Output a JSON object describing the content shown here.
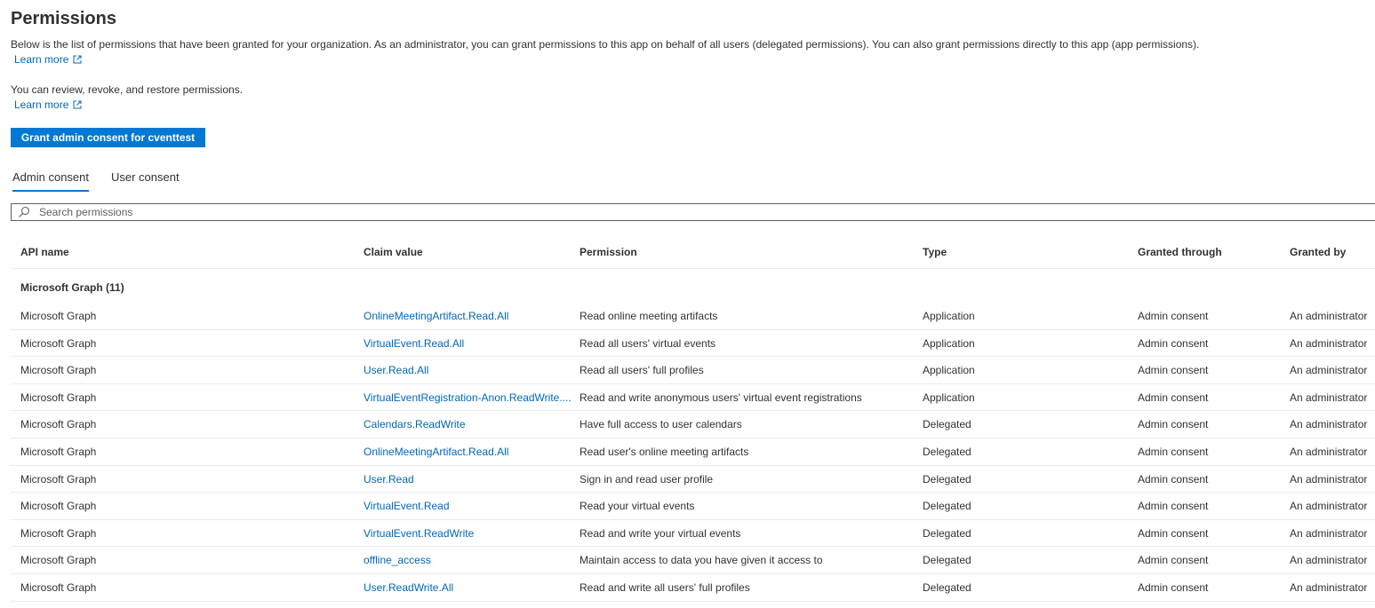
{
  "page": {
    "title": "Permissions",
    "description1": "Below is the list of permissions that have been granted for your organization. As an administrator, you can grant permissions to this app on behalf of all users (delegated permissions). You can also grant permissions directly to this app (app permissions).",
    "learn_more_1": "Learn more",
    "description2": "You can review, revoke, and restore permissions.",
    "learn_more_2": "Learn more",
    "grant_button": "Grant admin consent for cventtest"
  },
  "tabs": [
    {
      "label": "Admin consent",
      "active": true
    },
    {
      "label": "User consent",
      "active": false
    }
  ],
  "search": {
    "placeholder": "Search permissions",
    "value": ""
  },
  "table": {
    "columns": [
      "API name",
      "Claim value",
      "Permission",
      "Type",
      "Granted through",
      "Granted by"
    ],
    "group_label": "Microsoft Graph (11)",
    "rows": [
      {
        "api": "Microsoft Graph",
        "claim": "OnlineMeetingArtifact.Read.All",
        "permission": "Read online meeting artifacts",
        "type": "Application",
        "through": "Admin consent",
        "by": "An administrator"
      },
      {
        "api": "Microsoft Graph",
        "claim": "VirtualEvent.Read.All",
        "permission": "Read all users' virtual events",
        "type": "Application",
        "through": "Admin consent",
        "by": "An administrator"
      },
      {
        "api": "Microsoft Graph",
        "claim": "User.Read.All",
        "permission": "Read all users' full profiles",
        "type": "Application",
        "through": "Admin consent",
        "by": "An administrator"
      },
      {
        "api": "Microsoft Graph",
        "claim": "VirtualEventRegistration-Anon.ReadWrite....",
        "permission": "Read and write anonymous users' virtual event registrations",
        "type": "Application",
        "through": "Admin consent",
        "by": "An administrator"
      },
      {
        "api": "Microsoft Graph",
        "claim": "Calendars.ReadWrite",
        "permission": "Have full access to user calendars",
        "type": "Delegated",
        "through": "Admin consent",
        "by": "An administrator"
      },
      {
        "api": "Microsoft Graph",
        "claim": "OnlineMeetingArtifact.Read.All",
        "permission": "Read user's online meeting artifacts",
        "type": "Delegated",
        "through": "Admin consent",
        "by": "An administrator"
      },
      {
        "api": "Microsoft Graph",
        "claim": "User.Read",
        "permission": "Sign in and read user profile",
        "type": "Delegated",
        "through": "Admin consent",
        "by": "An administrator"
      },
      {
        "api": "Microsoft Graph",
        "claim": "VirtualEvent.Read",
        "permission": "Read your virtual events",
        "type": "Delegated",
        "through": "Admin consent",
        "by": "An administrator"
      },
      {
        "api": "Microsoft Graph",
        "claim": "VirtualEvent.ReadWrite",
        "permission": "Read and write your virtual events",
        "type": "Delegated",
        "through": "Admin consent",
        "by": "An administrator"
      },
      {
        "api": "Microsoft Graph",
        "claim": "offline_access",
        "permission": "Maintain access to data you have given it access to",
        "type": "Delegated",
        "through": "Admin consent",
        "by": "An administrator"
      },
      {
        "api": "Microsoft Graph",
        "claim": "User.ReadWrite.All",
        "permission": "Read and write all users' full profiles",
        "type": "Delegated",
        "through": "Admin consent",
        "by": "An administrator"
      }
    ]
  },
  "icons": {
    "external_link": "external-link-icon",
    "search": "search-icon"
  },
  "colors": {
    "accent": "#0078d4",
    "link": "#0067b8",
    "text": "#323130",
    "divider": "#edebe9"
  }
}
